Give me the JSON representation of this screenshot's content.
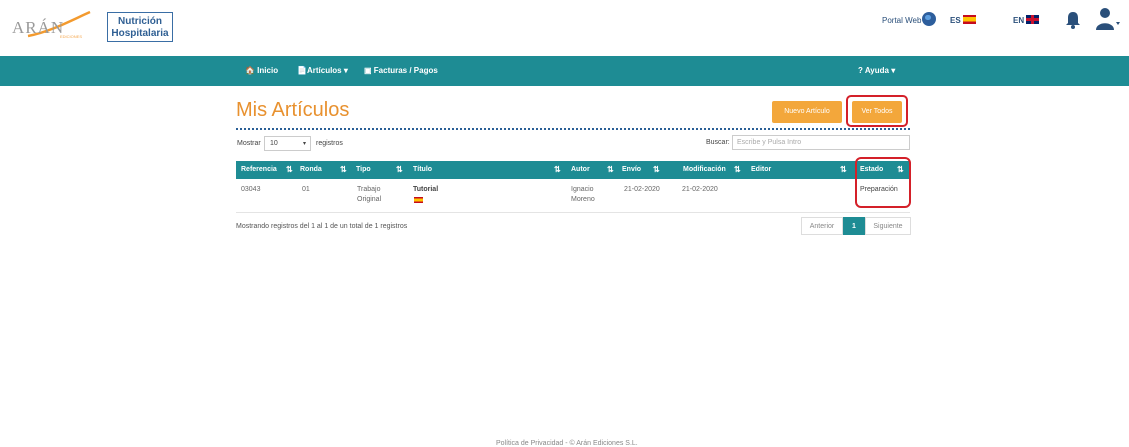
{
  "header": {
    "logo_text": "ARÁN",
    "logo_sub": "EDICIONES",
    "journal_line1": "Nutrición",
    "journal_line2": "Hospitalaria",
    "portal_web": "Portal Web",
    "lang_es": "ES",
    "lang_en": "EN"
  },
  "nav": {
    "home": "🏠 Inicio",
    "articles": "📄Artículos ▾",
    "invoices": "▣ Facturas / Pagos",
    "help": "? Ayuda ▾"
  },
  "main": {
    "title": "Mis Artículos",
    "new_button": "Nuevo Artículo",
    "all_button": "Ver Todos",
    "show_label": "Mostrar",
    "page_length": "10",
    "records_label": "registros",
    "search_label": "Buscar:",
    "search_placeholder": "Escribe y Pulsa Intro",
    "columns": [
      "Referencia",
      "Ronda",
      "Tipo",
      "Título",
      "Autor",
      "Envío",
      "Modificación",
      "Editor",
      "Estado"
    ],
    "rows": [
      {
        "referencia": "03043",
        "ronda": "01",
        "tipo_line1": "Trabajo",
        "tipo_line2": "Original",
        "titulo": "Tutorial",
        "autor_line1": "Ignacio",
        "autor_line2": "Moreno",
        "envio": "21-02-2020",
        "modificacion": "21-02-2020",
        "editor": "",
        "estado": "Preparación"
      }
    ],
    "info": "Mostrando registros del 1 al 1 de un total de 1 registros",
    "pager": {
      "prev": "Anterior",
      "current": "1",
      "next": "Siguiente"
    }
  },
  "footer": {
    "text": "Política de Privacidad - © Arán Ediciones S.L."
  },
  "colors": {
    "teal": "#1e8c94",
    "orange": "#f3a73b",
    "title_orange": "#e8912f",
    "highlight_red": "#d42029"
  }
}
